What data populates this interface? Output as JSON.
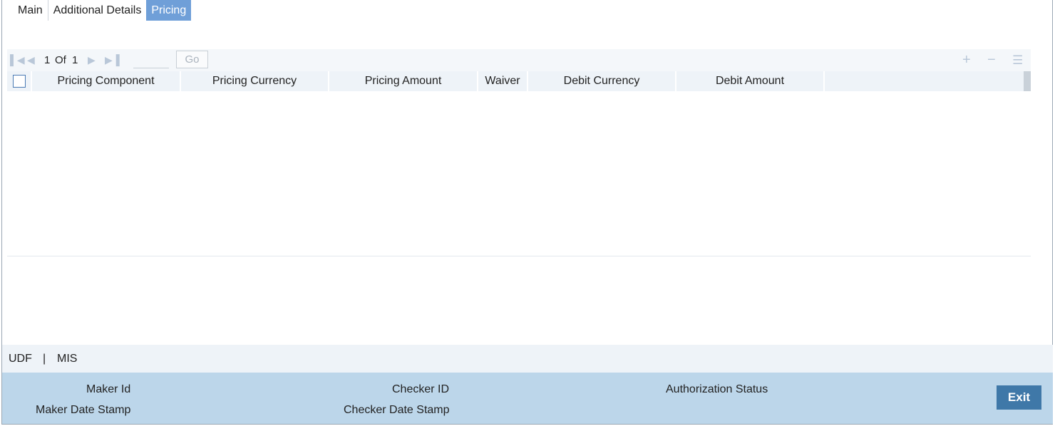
{
  "tabs": [
    {
      "label": "Main"
    },
    {
      "label": "Additional Details"
    },
    {
      "label": "Pricing"
    }
  ],
  "pager": {
    "current": "1",
    "of_label": "Of",
    "total": "1",
    "go_label": "Go"
  },
  "grid": {
    "columns": [
      "Pricing Component",
      "Pricing Currency",
      "Pricing Amount",
      "Waiver",
      "Debit Currency",
      "Debit Amount"
    ]
  },
  "links": {
    "udf": "UDF",
    "separator": "|",
    "mis": "MIS"
  },
  "footer": {
    "maker_id": "Maker Id",
    "maker_date": "Maker Date Stamp",
    "checker_id": "Checker ID",
    "checker_date": "Checker Date Stamp",
    "auth_status": "Authorization Status",
    "exit_label": "Exit"
  },
  "colors": {
    "active_tab": "#6f9fd8",
    "footer_bg": "#bcd6ea",
    "exit_button": "#3f78a8"
  }
}
